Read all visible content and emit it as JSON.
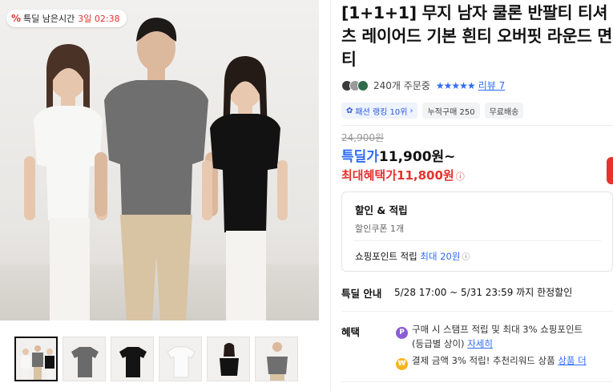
{
  "gallery": {
    "timer_label": "특딜 남은시간",
    "timer_value": "3일 02:38",
    "thumbnail_count": 6
  },
  "product": {
    "title": "[1+1+1] 무지 남자 쿨론 반팔티 티셔츠 레이어드 기본 흰티 오버핏 라운드 면티",
    "orders": "240개 주문중",
    "stars": "★★★★★",
    "review_label": "리뷰 7",
    "chips": [
      "패션 랭킹 10위",
      "누적구매 250",
      "무료배송"
    ],
    "original_price": "24,900원",
    "deal_label": "특딜가",
    "deal_price": "11,900원~",
    "max_benefit_label": "최대혜택가",
    "max_benefit_price": "11,800원"
  },
  "discount_box": {
    "heading": "할인 & 적립",
    "coupon": "할인쿠폰 1개",
    "points_label": "쇼핑포인트 적립",
    "points_value": "최대 20원"
  },
  "deal_guide": {
    "label": "특딜 안내",
    "value": "5/28 17:00 ~ 5/31 23:59 까지 한정할인"
  },
  "benefits": {
    "label": "혜택",
    "line1": "구매 시 스탬프 적립 및 최대 3% 쇼핑포인트",
    "line1b": "(등급별 상이)",
    "line1_link": "자세히",
    "line2": "결제 금액 3% 적립! 추천리워드 상품",
    "line2_link": "상품 더"
  },
  "colors": {
    "accent_blue": "#2f6cf6",
    "accent_red": "#e5322d"
  }
}
